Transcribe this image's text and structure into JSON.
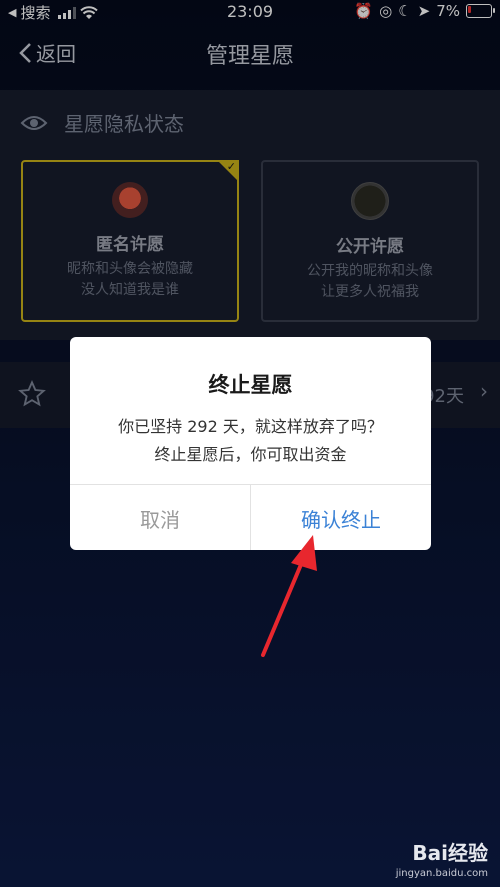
{
  "status_bar": {
    "carrier": "搜索",
    "time": "23:09",
    "battery": "7%"
  },
  "nav": {
    "back_label": "返回",
    "title": "管理星愿"
  },
  "privacy": {
    "header": "星愿隐私状态",
    "options": [
      {
        "title": "匿名许愿",
        "desc_line1": "昵称和头像会被隐藏",
        "desc_line2": "没人知道我是谁",
        "selected": true
      },
      {
        "title": "公开许愿",
        "desc_line1": "公开我的昵称和头像",
        "desc_line2": "让更多人祝福我",
        "selected": false
      }
    ]
  },
  "goal_row": {
    "days_text": "92天"
  },
  "dialog": {
    "title": "终止星愿",
    "line1": "你已坚持 292 天，就这样放弃了吗？",
    "line2": "终止星愿后，你可取出资金",
    "cancel_label": "取消",
    "confirm_label": "确认终止"
  },
  "watermark": {
    "brand": "Bai经验",
    "url": "jingyan.baidu.com"
  },
  "colors": {
    "accent_gold": "#c9b01a",
    "confirm_blue": "#3b82d6",
    "arrow_red": "#e8272e"
  }
}
